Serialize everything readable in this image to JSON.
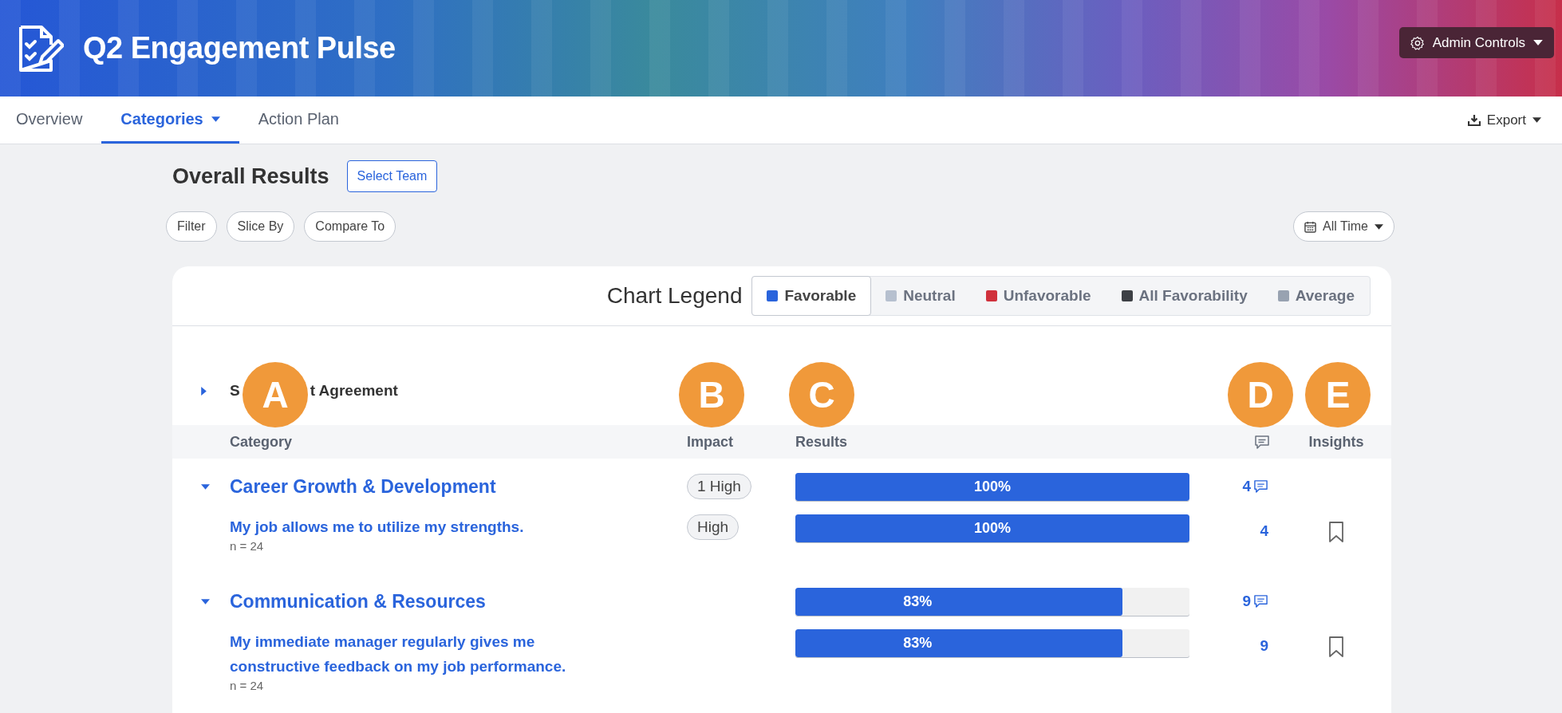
{
  "header": {
    "title": "Q2 Engagement Pulse",
    "admin_button": "Admin Controls"
  },
  "tabs": [
    {
      "label": "Overview",
      "selected": false,
      "has_menu": false
    },
    {
      "label": "Categories",
      "selected": true,
      "has_menu": true
    },
    {
      "label": "Action Plan",
      "selected": false,
      "has_menu": false
    }
  ],
  "export": "Export",
  "page_title": "Overall Results",
  "select_team": "Select Team",
  "filters": [
    "Filter",
    "Slice By",
    "Compare To"
  ],
  "date_range": "All Time",
  "legend": {
    "title": "Chart Legend",
    "items": [
      {
        "label": "Favorable",
        "color": "#2a64dc",
        "selected": true
      },
      {
        "label": "Neutral",
        "color": "#b6c0cf",
        "selected": false
      },
      {
        "label": "Unfavorable",
        "color": "#d0313c",
        "selected": false
      },
      {
        "label": "All Favorability",
        "color": "#3d4045",
        "selected": false
      },
      {
        "label": "Average",
        "color": "#98a2b1",
        "selected": false
      }
    ]
  },
  "section": {
    "label_start": "S",
    "label_end": "t Agreement",
    "expanded": false
  },
  "columns": {
    "category": "Category",
    "impact": "Impact",
    "results": "Results",
    "insights": "Insights"
  },
  "rows": [
    {
      "kind": "category",
      "title": "Career Growth & Development",
      "expanded": true,
      "impact": "1 High",
      "level": 1,
      "reading": "100%",
      "comments": "4"
    },
    {
      "kind": "question",
      "title": "My job allows me to utilize my strengths.",
      "n": "n = 24",
      "impact": "High",
      "level": 1,
      "reading": "100%",
      "comments": "4",
      "bookmarked": false
    },
    {
      "kind": "category",
      "title": "Communication & Resources",
      "expanded": true,
      "level": 0.83,
      "reading": "83%",
      "comments": "9"
    },
    {
      "kind": "question",
      "title": "My immediate manager regularly gives me constructive feedback on my job performance.",
      "n": "n = 24",
      "level": 0.83,
      "reading": "83%",
      "comments": "9",
      "bookmarked": false
    }
  ],
  "annotations": [
    "A",
    "B",
    "C",
    "D",
    "E"
  ]
}
